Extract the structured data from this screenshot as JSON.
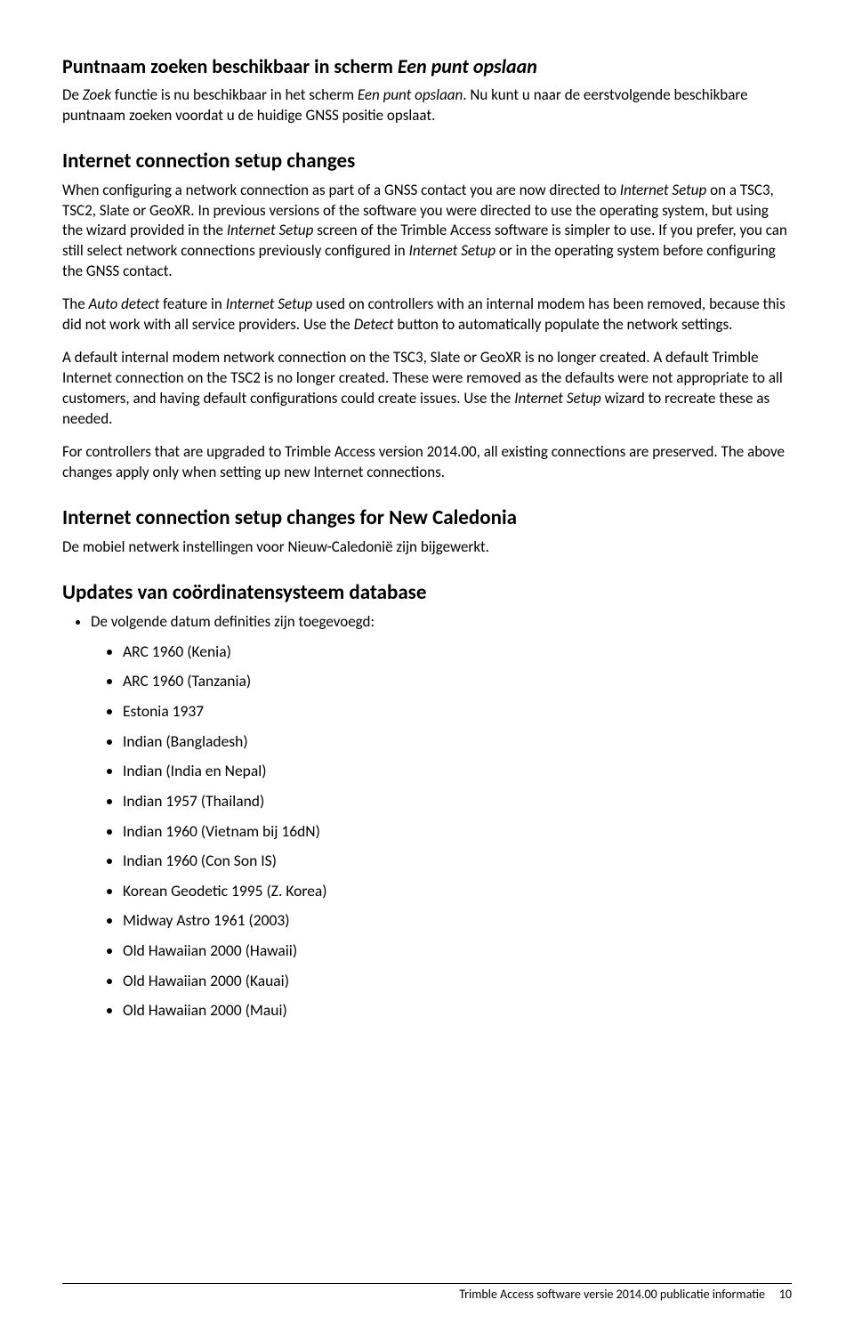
{
  "sections": {
    "s1": {
      "heading_pre": "Puntnaam zoeken beschikbaar in scherm ",
      "heading_em": "Een punt opslaan",
      "p1_a": "De ",
      "p1_b": "Zoek",
      "p1_c": " functie is nu beschikbaar in het scherm ",
      "p1_d": "Een punt opslaan",
      "p1_e": ". Nu kunt u naar de eerstvolgende beschikbare puntnaam zoeken voordat u de huidige GNSS positie opslaat."
    },
    "s2": {
      "heading": "Internet connection setup changes",
      "p1_a": "When configuring a network connection as part of a GNSS contact you are now directed to ",
      "p1_b": "Internet Setup",
      "p1_c": " on a TSC3, TSC2, Slate or GeoXR. In previous versions of the software you were directed to use the operating system, but using the wizard provided in the ",
      "p1_d": "Internet Setup",
      "p1_e": " screen of the Trimble Access software is simpler to use. If you prefer, you can still select network connections previously configured in ",
      "p1_f": "Internet Setup",
      "p1_g": " or in the operating system before configuring the GNSS contact.",
      "p2_a": "The ",
      "p2_b": "Auto detect",
      "p2_c": " feature in ",
      "p2_d": "Internet Setup",
      "p2_e": " used on controllers with an internal modem has been removed, because this did not work with all service providers. Use the ",
      "p2_f": "Detect",
      "p2_g": " button to automatically populate the network settings.",
      "p3_a": "A default internal modem network connection on the TSC3, Slate or GeoXR is no longer created. A default Trimble Internet connection on the TSC2 is no longer created. These were removed as the defaults were not appropriate to all customers, and having default configurations could create issues. Use the ",
      "p3_b": "Internet Setup",
      "p3_c": " wizard to recreate these as needed.",
      "p4": "For controllers that are upgraded to Trimble Access version 2014.00, all existing connections are preserved. The above changes apply only when setting up new Internet connections."
    },
    "s3": {
      "heading": "Internet connection setup changes for New Caledonia",
      "p1": "De mobiel netwerk instellingen voor Nieuw-Caledonië zijn bijgewerkt."
    },
    "s4": {
      "heading": "Updates van coördinatensysteem database",
      "intro": "De volgende datum definities zijn toegevoegd:",
      "items": [
        "ARC 1960 (Kenia)",
        "ARC 1960 (Tanzania)",
        "Estonia 1937",
        "Indian (Bangladesh)",
        "Indian (India en Nepal)",
        "Indian 1957 (Thailand)",
        "Indian 1960 (Vietnam bij 16dN)",
        "Indian 1960 (Con Son IS)",
        "Korean Geodetic 1995 (Z. Korea)",
        "Midway Astro 1961 (2003)",
        "Old Hawaiian 2000 (Hawaii)",
        "Old Hawaiian 2000 (Kauai)",
        "Old Hawaiian 2000 (Maui)"
      ]
    }
  },
  "footer": {
    "text": "Trimble Access software versie 2014.00 publicatie informatie",
    "page": "10"
  }
}
